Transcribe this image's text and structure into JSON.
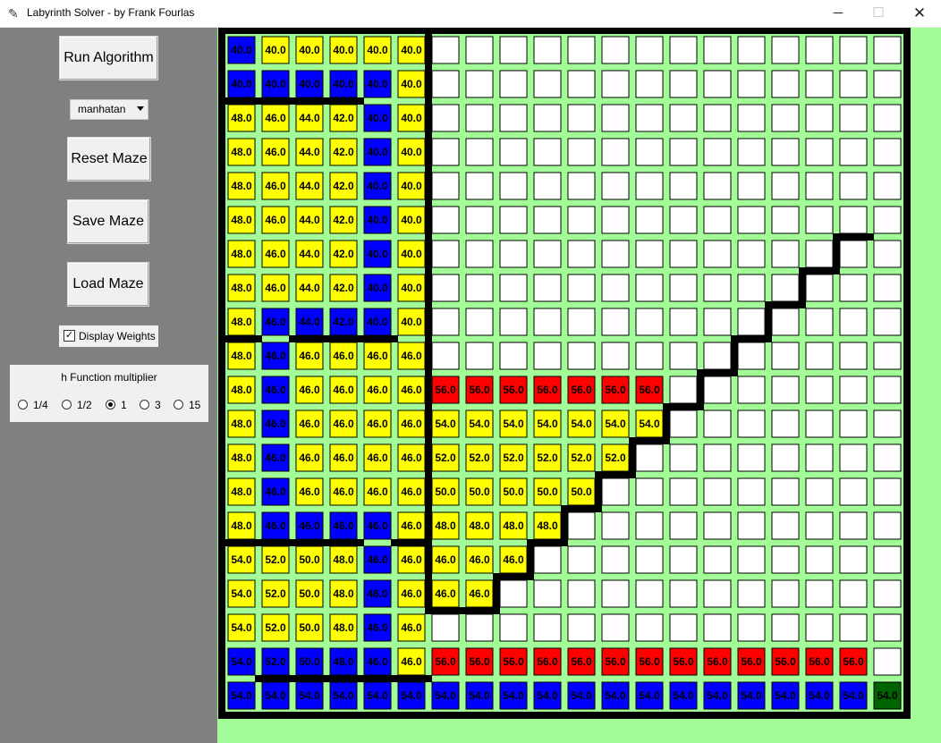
{
  "window": {
    "title": "Labyrinth Solver - by Frank Fourlas",
    "minimize_icon": "─",
    "maximize_icon": "☐",
    "close_icon": "✕"
  },
  "sidebar": {
    "run_label": "Run Algorithm",
    "heuristic_value": "manhatan",
    "reset_label": "Reset Maze",
    "save_label": "Save Maze",
    "load_label": "Load Maze",
    "display_weights_label": "Display Weights",
    "display_weights_checked": true,
    "hmult_title": "h Function multiplier",
    "hmult_options": [
      {
        "label": "1/4",
        "selected": false
      },
      {
        "label": "1/2",
        "selected": false
      },
      {
        "label": "1",
        "selected": true
      },
      {
        "label": "3",
        "selected": false
      },
      {
        "label": "15",
        "selected": false
      }
    ]
  },
  "colors": {
    "canvas_bg": "#a2fc98",
    "white": "#ffffff",
    "yellow": "#ffff00",
    "blue": "#0000ff",
    "red": "#ff0000",
    "goal": "#006400",
    "wall": "#000000"
  },
  "maze": {
    "cols": 20,
    "rows": 20,
    "legend": {
      "W": "white",
      "Y": "yellow",
      "B": "blue",
      "R": "red",
      "G": "goal"
    },
    "cells": [
      "BYYYYYWWWWWWWWWWWWWW",
      "BBBBBYWWWWWWWWWWWWWW",
      "YYYYBYWWWWWWWWWWWWWW",
      "YYYYBYWWWWWWWWWWWWWW",
      "YYYYBYWWWWWWWWWWWWWW",
      "YYYYBYWWWWWWWWWWWWWW",
      "YYYYBYWWWWWWWWWWWWWW",
      "YYYYBYWWWWWWWWWWWWWW",
      "YBBBBYWWWWWWWWWWWWWW",
      "YBYYYYWWWWWWWWWWWWWW",
      "YBYYYYRRRRRRRWWWWWWW",
      "YBYYYYYYYYYYYWWWWWWW",
      "YBYYYYYYYYYYWWWWWWWW",
      "YBYYYYYYYYYWWWWWWWWW",
      "YBBBBYYYYYWWWWWWWWWW",
      "YYYYBYYYYWWWWWWWWWWW",
      "YYYYBYYYWWWWWWWWWWWW",
      "YYYYBYWWWWWWWWWWWWWW",
      "BBBBBYRRRRRRRRRRRRRW",
      "BBBBBBBBBBBBBBBBBBBG"
    ],
    "values": [
      [
        "40.0",
        "40.0",
        "40.0",
        "40.0",
        "40.0",
        "40.0"
      ],
      [
        "40.0",
        "40.0",
        "40.0",
        "40.0",
        "40.0",
        "40.0"
      ],
      [
        "48.0",
        "46.0",
        "44.0",
        "42.0",
        "40.0",
        "40.0"
      ],
      [
        "48.0",
        "46.0",
        "44.0",
        "42.0",
        "40.0",
        "40.0"
      ],
      [
        "48.0",
        "46.0",
        "44.0",
        "42.0",
        "40.0",
        "40.0"
      ],
      [
        "48.0",
        "46.0",
        "44.0",
        "42.0",
        "40.0",
        "40.0"
      ],
      [
        "48.0",
        "46.0",
        "44.0",
        "42.0",
        "40.0",
        "40.0"
      ],
      [
        "48.0",
        "46.0",
        "44.0",
        "42.0",
        "40.0",
        "40.0"
      ],
      [
        "48.0",
        "46.0",
        "44.0",
        "42.0",
        "40.0",
        "40.0"
      ],
      [
        "48.0",
        "46.0",
        "46.0",
        "46.0",
        "46.0",
        "46.0"
      ],
      [
        "48.0",
        "46.0",
        "46.0",
        "46.0",
        "46.0",
        "46.0",
        "56.0",
        "56.0",
        "56.0",
        "56.0",
        "56.0",
        "56.0",
        "56.0"
      ],
      [
        "48.0",
        "46.0",
        "46.0",
        "46.0",
        "46.0",
        "46.0",
        "54.0",
        "54.0",
        "54.0",
        "54.0",
        "54.0",
        "54.0",
        "54.0"
      ],
      [
        "48.0",
        "46.0",
        "46.0",
        "46.0",
        "46.0",
        "46.0",
        "52.0",
        "52.0",
        "52.0",
        "52.0",
        "52.0",
        "52.0"
      ],
      [
        "48.0",
        "46.0",
        "46.0",
        "46.0",
        "46.0",
        "46.0",
        "50.0",
        "50.0",
        "50.0",
        "50.0",
        "50.0"
      ],
      [
        "48.0",
        "46.0",
        "46.0",
        "46.0",
        "46.0",
        "46.0",
        "48.0",
        "48.0",
        "48.0",
        "48.0"
      ],
      [
        "54.0",
        "52.0",
        "50.0",
        "48.0",
        "46.0",
        "46.0",
        "46.0",
        "46.0",
        "46.0"
      ],
      [
        "54.0",
        "52.0",
        "50.0",
        "48.0",
        "46.0",
        "46.0",
        "46.0",
        "46.0"
      ],
      [
        "54.0",
        "52.0",
        "50.0",
        "48.0",
        "46.0",
        "46.0"
      ],
      [
        "54.0",
        "52.0",
        "50.0",
        "48.0",
        "46.0",
        "46.0",
        "56.0",
        "56.0",
        "56.0",
        "56.0",
        "56.0",
        "56.0",
        "56.0",
        "56.0",
        "56.0",
        "56.0",
        "56.0",
        "56.0",
        "56.0"
      ],
      [
        "54.0",
        "54.0",
        "54.0",
        "54.0",
        "54.0",
        "54.0",
        "54.0",
        "54.0",
        "54.0",
        "54.0",
        "54.0",
        "54.0",
        "54.0",
        "54.0",
        "54.0",
        "54.0",
        "54.0",
        "54.0",
        "54.0",
        "54.0"
      ]
    ],
    "horizontal_walls": [
      {
        "row_boundary": 2,
        "from_col": 0,
        "to_col": 4
      },
      {
        "row_boundary": 9,
        "from_col": 0,
        "to_col": 1
      },
      {
        "row_boundary": 9,
        "from_col": 2,
        "to_col": 5
      },
      {
        "row_boundary": 15,
        "from_col": 0,
        "to_col": 4
      },
      {
        "row_boundary": 15,
        "from_col": 5,
        "to_col": 6
      },
      {
        "row_boundary": 19,
        "from_col": 1,
        "to_col": 6
      },
      {
        "row_boundary": 17,
        "from_col": 6,
        "to_col": 8
      },
      {
        "row_boundary": 16,
        "from_col": 8,
        "to_col": 9
      },
      {
        "row_boundary": 15,
        "from_col": 9,
        "to_col": 10
      },
      {
        "row_boundary": 14,
        "from_col": 10,
        "to_col": 11
      },
      {
        "row_boundary": 13,
        "from_col": 11,
        "to_col": 12
      },
      {
        "row_boundary": 12,
        "from_col": 12,
        "to_col": 13
      },
      {
        "row_boundary": 11,
        "from_col": 13,
        "to_col": 14
      },
      {
        "row_boundary": 10,
        "from_col": 14,
        "to_col": 15
      },
      {
        "row_boundary": 9,
        "from_col": 15,
        "to_col": 16
      },
      {
        "row_boundary": 8,
        "from_col": 16,
        "to_col": 17
      },
      {
        "row_boundary": 7,
        "from_col": 17,
        "to_col": 18
      },
      {
        "row_boundary": 6,
        "from_col": 18,
        "to_col": 19
      }
    ],
    "vertical_walls": [
      {
        "col_boundary": 6,
        "from_row": 0,
        "to_row": 17
      },
      {
        "col_boundary": 8,
        "from_row": 16,
        "to_row": 17
      },
      {
        "col_boundary": 9,
        "from_row": 15,
        "to_row": 16
      },
      {
        "col_boundary": 10,
        "from_row": 14,
        "to_row": 15
      },
      {
        "col_boundary": 11,
        "from_row": 13,
        "to_row": 14
      },
      {
        "col_boundary": 12,
        "from_row": 12,
        "to_row": 13
      },
      {
        "col_boundary": 13,
        "from_row": 11,
        "to_row": 12
      },
      {
        "col_boundary": 14,
        "from_row": 10,
        "to_row": 11
      },
      {
        "col_boundary": 15,
        "from_row": 9,
        "to_row": 10
      },
      {
        "col_boundary": 16,
        "from_row": 8,
        "to_row": 9
      },
      {
        "col_boundary": 17,
        "from_row": 7,
        "to_row": 8
      },
      {
        "col_boundary": 18,
        "from_row": 6,
        "to_row": 7
      }
    ]
  }
}
